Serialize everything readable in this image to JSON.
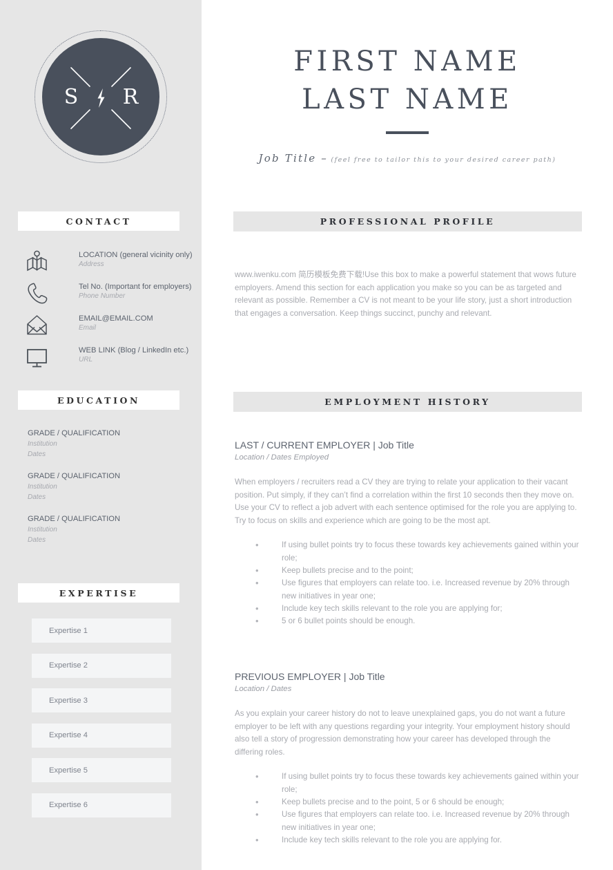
{
  "colors": {
    "sidebar_bg": "#e6e6e6",
    "logo_dark": "#49505c",
    "accent_dark": "#49505c",
    "body_text": "#a8aab0",
    "heading_text": "#5c636e",
    "expertise_box": "#f4f5f6",
    "band_bg": "#e6e6e6"
  },
  "logo": {
    "left_initial": "S",
    "right_initial": "R",
    "center_icon": "lightning-bolt-icon"
  },
  "header": {
    "first_name": "FIRST NAME",
    "last_name": "LAST NAME",
    "job_title": "Job Title –",
    "job_note": "(feel free to tailor this to your desired career path)"
  },
  "sidebar": {
    "sections": [
      {
        "title": "CONTACT"
      },
      {
        "title": "EDUCATION"
      },
      {
        "title": "EXPERTISE"
      }
    ],
    "contact": {
      "title": "CONTACT",
      "items": [
        {
          "icon": "map-pin-icon",
          "main": "LOCATION (general vicinity only)",
          "sub": "Address"
        },
        {
          "icon": "phone-icon",
          "main": "Tel No. (Important for employers)",
          "sub": "Phone Number"
        },
        {
          "icon": "envelope-icon",
          "main": "EMAIL@EMAIL.COM",
          "sub": "Email"
        },
        {
          "icon": "monitor-icon",
          "main": "WEB LINK (Blog / LinkedIn etc.)",
          "sub": "URL"
        }
      ]
    },
    "education": {
      "title": "EDUCATION",
      "items": [
        {
          "grade": "GRADE / QUALIFICATION",
          "institution": "Institution",
          "dates": "Dates"
        },
        {
          "grade": "GRADE / QUALIFICATION",
          "institution": "Institution",
          "dates": "Dates"
        },
        {
          "grade": "GRADE / QUALIFICATION",
          "institution": "Institution",
          "dates": "Dates"
        }
      ]
    },
    "expertise": {
      "title": "EXPERTISE",
      "items": [
        "Expertise 1",
        "Expertise 2",
        "Expertise 3",
        "Expertise 4",
        "Expertise 5",
        "Expertise 6"
      ]
    }
  },
  "main": {
    "profile": {
      "title": "PROFESSIONAL PROFILE",
      "body": "www.iwenku.com 简历模板免费下载!Use this box to make a powerful statement that wows future employers.  Amend this section for each application you make so you can be as targeted and relevant as possible. Remember a CV is not meant to be your life story, just a short introduction that engages a conversation.  Keep things succinct, punchy and relevant."
    },
    "employment": {
      "title": "EMPLOYMENT HISTORY",
      "jobs": [
        {
          "heading": "LAST / CURRENT EMPLOYER | Job Title",
          "subheading": "Location / Dates Employed",
          "paragraph": "When employers / recruiters read a CV they are trying to relate your application to their vacant position.  Put simply, if they can’t find a correlation within the first 10 seconds then they move on.   Use your CV to reflect a job advert with each sentence optimised for the role you are applying to. Try to focus on skills and experience which are going to be the most apt.",
          "bullets": [
            "If using bullet points try to focus these towards key achievements gained within your role;",
            "Keep bullets precise and to the point;",
            "Use figures that employers can relate too. i.e. Increased revenue by 20% through new initiatives in year one;",
            "Include key tech skills relevant to the role you are applying for;",
            "5 or 6 bullet points should be enough."
          ]
        },
        {
          "heading": "PREVIOUS EMPLOYER | Job Title",
          "subheading": "Location / Dates",
          "paragraph": "As you explain your career history do not to leave unexplained gaps, you do not want a future employer to be left with any questions regarding your integrity. Your employment history should also tell a story of progression demonstrating how your career has developed through the differing roles.",
          "bullets": [
            "If using bullet points try to focus these towards key achievements gained within your role;",
            "Keep bullets precise and to the point, 5 or 6 should be enough;",
            "Use figures that employers can relate too. i.e. Increased revenue by 20% through new initiatives in year one;",
            "Include key tech skills relevant to the role you are applying for."
          ]
        }
      ]
    }
  }
}
